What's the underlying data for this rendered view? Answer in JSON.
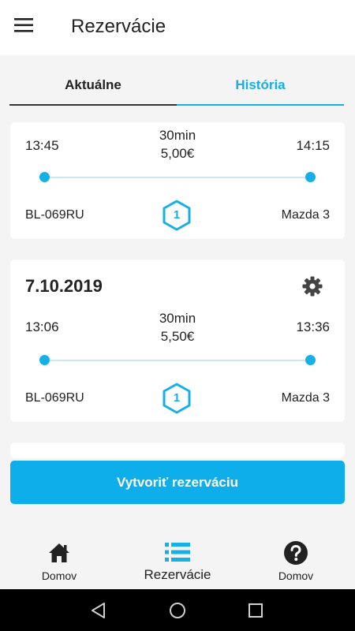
{
  "appbar": {
    "title": "Rezervácie",
    "menu_icon": "hamburger-menu-icon"
  },
  "tabs": [
    {
      "label": "Aktuálne",
      "active": false
    },
    {
      "label": "História",
      "active": true
    }
  ],
  "reservations": [
    {
      "date": "",
      "start_time": "13:45",
      "end_time": "14:15",
      "duration": "30min",
      "price": "5,00€",
      "plate": "BL-069RU",
      "zone": "1",
      "car": "Mazda 3"
    },
    {
      "date": "7.10.2019",
      "start_time": "13:06",
      "end_time": "13:36",
      "duration": "30min",
      "price": "5,50€",
      "plate": "BL-069RU",
      "zone": "1",
      "car": "Mazda 3",
      "settings_icon": "gear-icon"
    }
  ],
  "create_button": {
    "label": "Vytvoriť rezerváciu"
  },
  "bottom_nav": [
    {
      "label": "Domov",
      "icon": "home-icon",
      "active": false
    },
    {
      "label": "Rezervácie",
      "icon": "list-icon",
      "active": true
    },
    {
      "label": "Domov",
      "icon": "help-icon",
      "active": false
    }
  ],
  "colors": {
    "accent": "#14b0e6",
    "button": "#0eaeea",
    "background": "#f4f4f4"
  }
}
